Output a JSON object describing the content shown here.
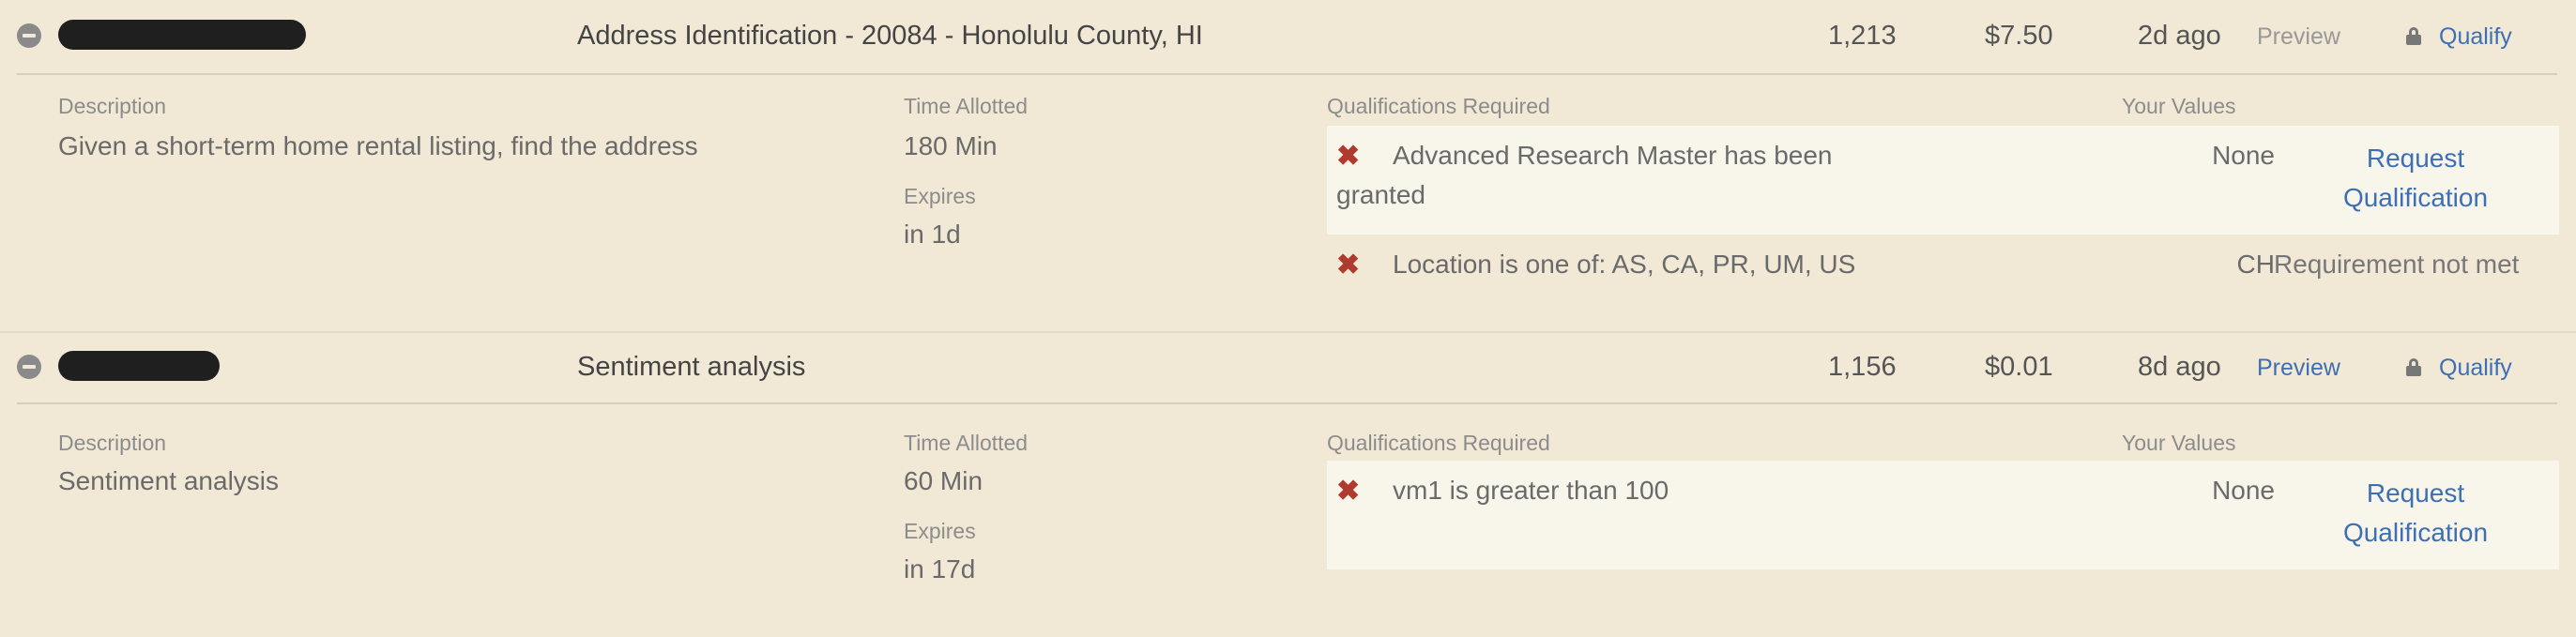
{
  "hits": [
    {
      "title": "Address Identification - 20084 - Honolulu County, HI",
      "hits_available": "1,213",
      "reward": "$7.50",
      "created": "2d ago",
      "preview_label": "Preview",
      "qualify_label": "Qualify",
      "description_label": "Description",
      "description": "Given a short-term home rental listing, find the address",
      "time_allotted_label": "Time Allotted",
      "time_allotted": "180 Min",
      "expires_label": "Expires",
      "expires": "in 1d",
      "qualifications_label": "Qualifications Required",
      "your_values_label": "Your Values",
      "qualifications": [
        {
          "text_line1": "Advanced Research Master has been",
          "text_line2": "granted",
          "your_value": "None",
          "action_line1": "Request",
          "action_line2": "Qualification"
        },
        {
          "text": "Location is one of: AS, CA, PR, UM, US",
          "your_value": "CH",
          "status": "Requirement not met"
        }
      ]
    },
    {
      "title": "Sentiment analysis",
      "hits_available": "1,156",
      "reward": "$0.01",
      "created": "8d ago",
      "preview_label": "Preview",
      "qualify_label": "Qualify",
      "description_label": "Description",
      "description": "Sentiment analysis",
      "time_allotted_label": "Time Allotted",
      "time_allotted": "60 Min",
      "expires_label": "Expires",
      "expires": "in 17d",
      "qualifications_label": "Qualifications Required",
      "your_values_label": "Your Values",
      "qualifications": [
        {
          "text": "vm1 is greater than 100",
          "your_value": "None",
          "action_line1": "Request",
          "action_line2": "Qualification"
        }
      ]
    }
  ]
}
